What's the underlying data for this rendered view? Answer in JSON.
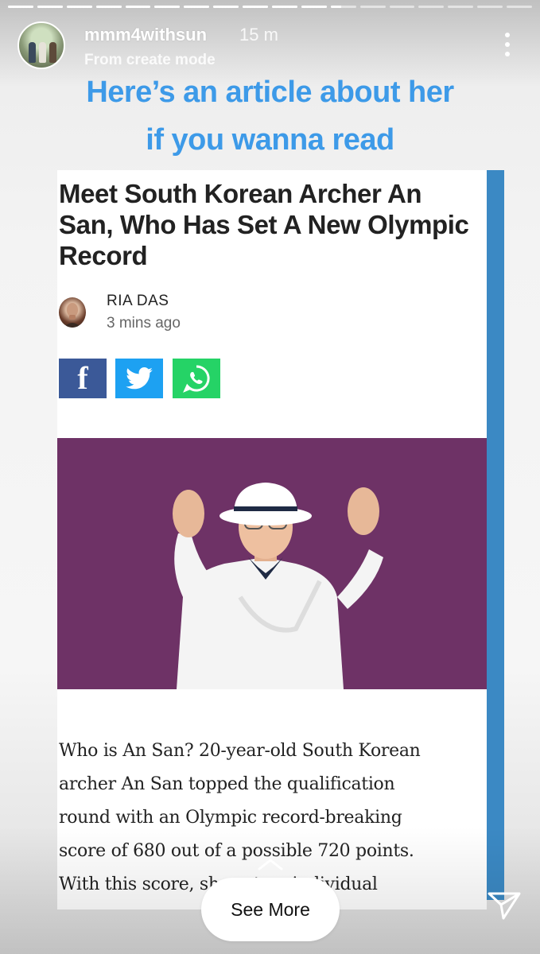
{
  "story": {
    "segments": [
      {
        "progress": 1
      },
      {
        "progress": 1
      },
      {
        "progress": 1
      },
      {
        "progress": 1
      },
      {
        "progress": 1
      },
      {
        "progress": 1
      },
      {
        "progress": 1
      },
      {
        "progress": 1
      },
      {
        "progress": 1
      },
      {
        "progress": 1
      },
      {
        "progress": 1
      },
      {
        "progress": 0.4
      },
      {
        "progress": 0
      },
      {
        "progress": 0
      },
      {
        "progress": 0
      },
      {
        "progress": 0
      },
      {
        "progress": 0
      },
      {
        "progress": 0
      }
    ]
  },
  "header": {
    "username": "mmm4withsun",
    "time_ago": "15 m",
    "subline": "From create mode"
  },
  "caption": {
    "line1": "Here’s an article about her",
    "line2": "if you wanna read",
    "color": "#3d9ae8"
  },
  "article": {
    "title": "Meet South Korean Archer An San, Who Has Set A New Olympic Record",
    "author": "RIA DAS",
    "published": "3 mins ago",
    "share": [
      {
        "network": "facebook",
        "icon": "facebook-icon",
        "color": "#3b5998"
      },
      {
        "network": "twitter",
        "icon": "twitter-icon",
        "color": "#1da1f2"
      },
      {
        "network": "whatsapp",
        "icon": "whatsapp-icon",
        "color": "#25d366"
      }
    ],
    "photo_background": "#6e3266",
    "body_lines": [
      "Who is An San? 20-year-old South Korean",
      "archer An San topped the qualification",
      "round with an Olympic record-breaking",
      "score of 680 out of a possible 720 points.",
      "With this score, she set an individual"
    ],
    "accent_bar_color": "#3b89c4"
  },
  "footer": {
    "see_more_label": "See More",
    "icons": [
      "chevron-up-icon",
      "send-icon"
    ]
  }
}
